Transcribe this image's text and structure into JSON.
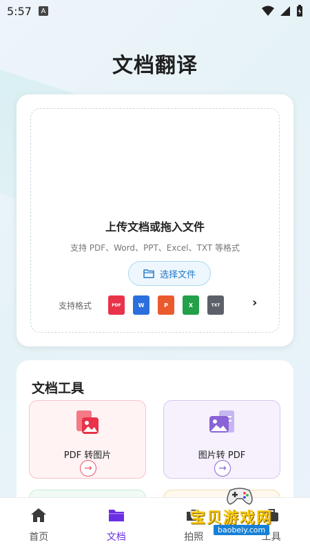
{
  "status_bar": {
    "time": "5:57",
    "notification_badge": "A"
  },
  "page": {
    "title": "文档翻译"
  },
  "upload": {
    "title": "上传文档或拖入文件",
    "subtitle": "支持 PDF、Word、PPT、Excel、TXT 等格式",
    "choose_button": "选择文件",
    "formats_label": "支持格式",
    "formats": [
      {
        "label": "PDF",
        "color": "#e8334a"
      },
      {
        "label": "W",
        "color": "#2b6fde"
      },
      {
        "label": "P",
        "color": "#ea5a2c"
      },
      {
        "label": "X",
        "color": "#22a04a"
      },
      {
        "label": "TXT",
        "color": "#5c6068"
      }
    ],
    "more_glyph": "›"
  },
  "tools": {
    "title": "文档工具",
    "items": [
      {
        "label": "PDF 转图片",
        "icon": "pdf-to-image-icon",
        "accent": "#e8556a",
        "arrow": "→"
      },
      {
        "label": "图片转 PDF",
        "icon": "image-to-pdf-icon",
        "accent": "#8a63d6",
        "arrow": "→"
      }
    ]
  },
  "bottom_nav": [
    {
      "label": "首页",
      "icon": "home-icon",
      "active": false
    },
    {
      "label": "文档",
      "icon": "folder-icon",
      "active": true
    },
    {
      "label": "拍照",
      "icon": "camera-icon",
      "active": false
    },
    {
      "label": "工具",
      "icon": "toolbox-icon",
      "active": false
    }
  ],
  "watermark": {
    "title": "宝贝游戏网",
    "url": "baobeiy.com"
  },
  "colors": {
    "accent": "#6a2fe3",
    "link": "#2378c9"
  }
}
